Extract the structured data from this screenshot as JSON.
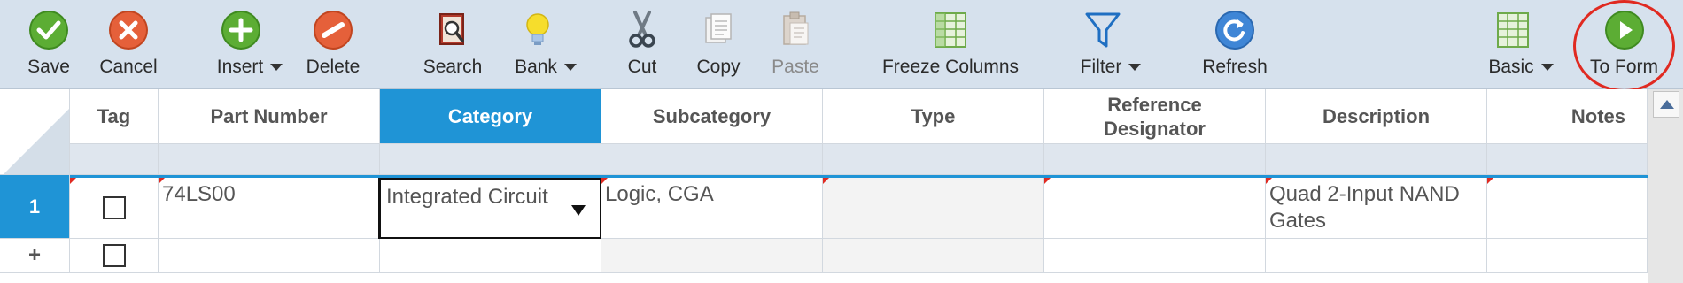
{
  "toolbar": {
    "save": "Save",
    "cancel": "Cancel",
    "insert": "Insert",
    "delete": "Delete",
    "search": "Search",
    "bank": "Bank",
    "cut": "Cut",
    "copy": "Copy",
    "paste": "Paste",
    "freeze_columns": "Freeze Columns",
    "filter": "Filter",
    "refresh": "Refresh",
    "basic": "Basic",
    "to_form": "To Form"
  },
  "columns": {
    "tag": "Tag",
    "part_number": "Part Number",
    "category": "Category",
    "subcategory": "Subcategory",
    "type": "Type",
    "reference_designator": "Reference Designator",
    "description": "Description",
    "notes": "Notes"
  },
  "rows": [
    {
      "row_label": "1",
      "part_number": "74LS00",
      "category": "Integrated Circuit",
      "subcategory": "Logic, CGA",
      "type": "",
      "reference_designator": "",
      "description": "Quad 2-Input NAND Gates",
      "notes": ""
    }
  ],
  "new_row_label": "+",
  "colors": {
    "toolbar_bg": "#d6e1ed",
    "selected_header": "#1f94d6",
    "highlight_ring": "#e02a21"
  },
  "icons": [
    "save-icon",
    "cancel-icon",
    "insert-icon",
    "delete-icon",
    "search-icon",
    "bank-icon",
    "cut-icon",
    "copy-icon",
    "paste-icon",
    "freeze-columns-icon",
    "filter-icon",
    "refresh-icon",
    "basic-view-icon",
    "to-form-icon"
  ]
}
